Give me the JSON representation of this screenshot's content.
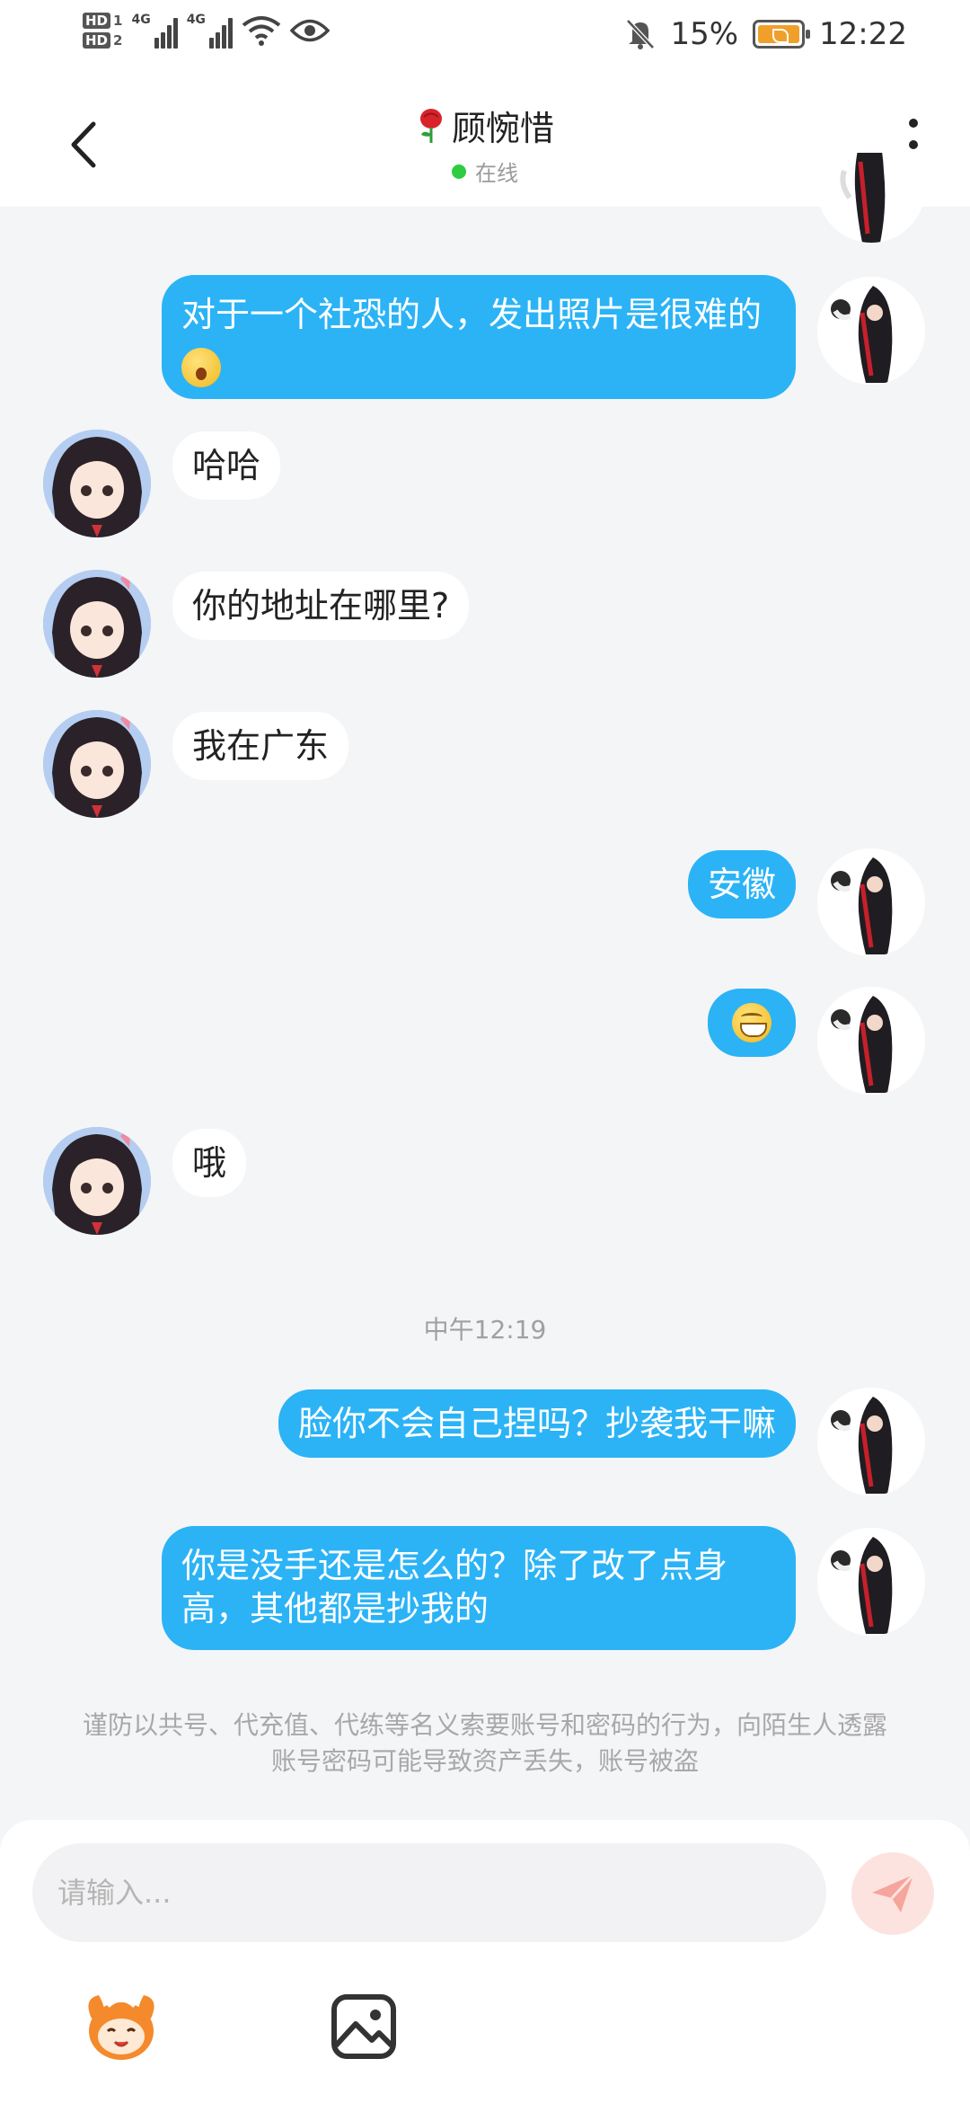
{
  "status_bar": {
    "sim1": "HD",
    "sim1_num": "1",
    "sim2": "HD",
    "sim2_num": "2",
    "net1": "4G",
    "net2": "4G",
    "battery": "15%",
    "time": "12:22"
  },
  "header": {
    "title": "顾惋惜",
    "status": "在线",
    "title_emoji_icon": "rose-icon"
  },
  "messages": [
    {
      "side": "out",
      "text": "对于一个社恐的人，发出照片是很难的",
      "emoji": "yawning-face"
    },
    {
      "side": "in",
      "text": "哈哈"
    },
    {
      "side": "in",
      "text": "你的地址在哪里?"
    },
    {
      "side": "in",
      "text": "我在广东"
    },
    {
      "side": "out",
      "text": "安徽"
    },
    {
      "side": "out",
      "text": "",
      "emoji": "grinning-face"
    },
    {
      "side": "in",
      "text": "哦"
    },
    {
      "side": "out",
      "text": "脸你不会自己捏吗？抄袭我干嘛"
    },
    {
      "side": "out",
      "text": "你是没手还是怎么的？除了改了点身高，其他都是抄我的"
    }
  ],
  "timestamp": "中午12:19",
  "notice": "谨防以共号、代充值、代练等名义索要账号和密码的行为，向陌生人透露账号密码可能导致资产丢失，账号被盗",
  "input": {
    "placeholder": "请输入..."
  },
  "colors": {
    "outgoing_bubble": "#2bb3f6",
    "incoming_bubble": "#ffffff",
    "background": "#f4f5f7",
    "online_dot": "#2ecc40"
  }
}
